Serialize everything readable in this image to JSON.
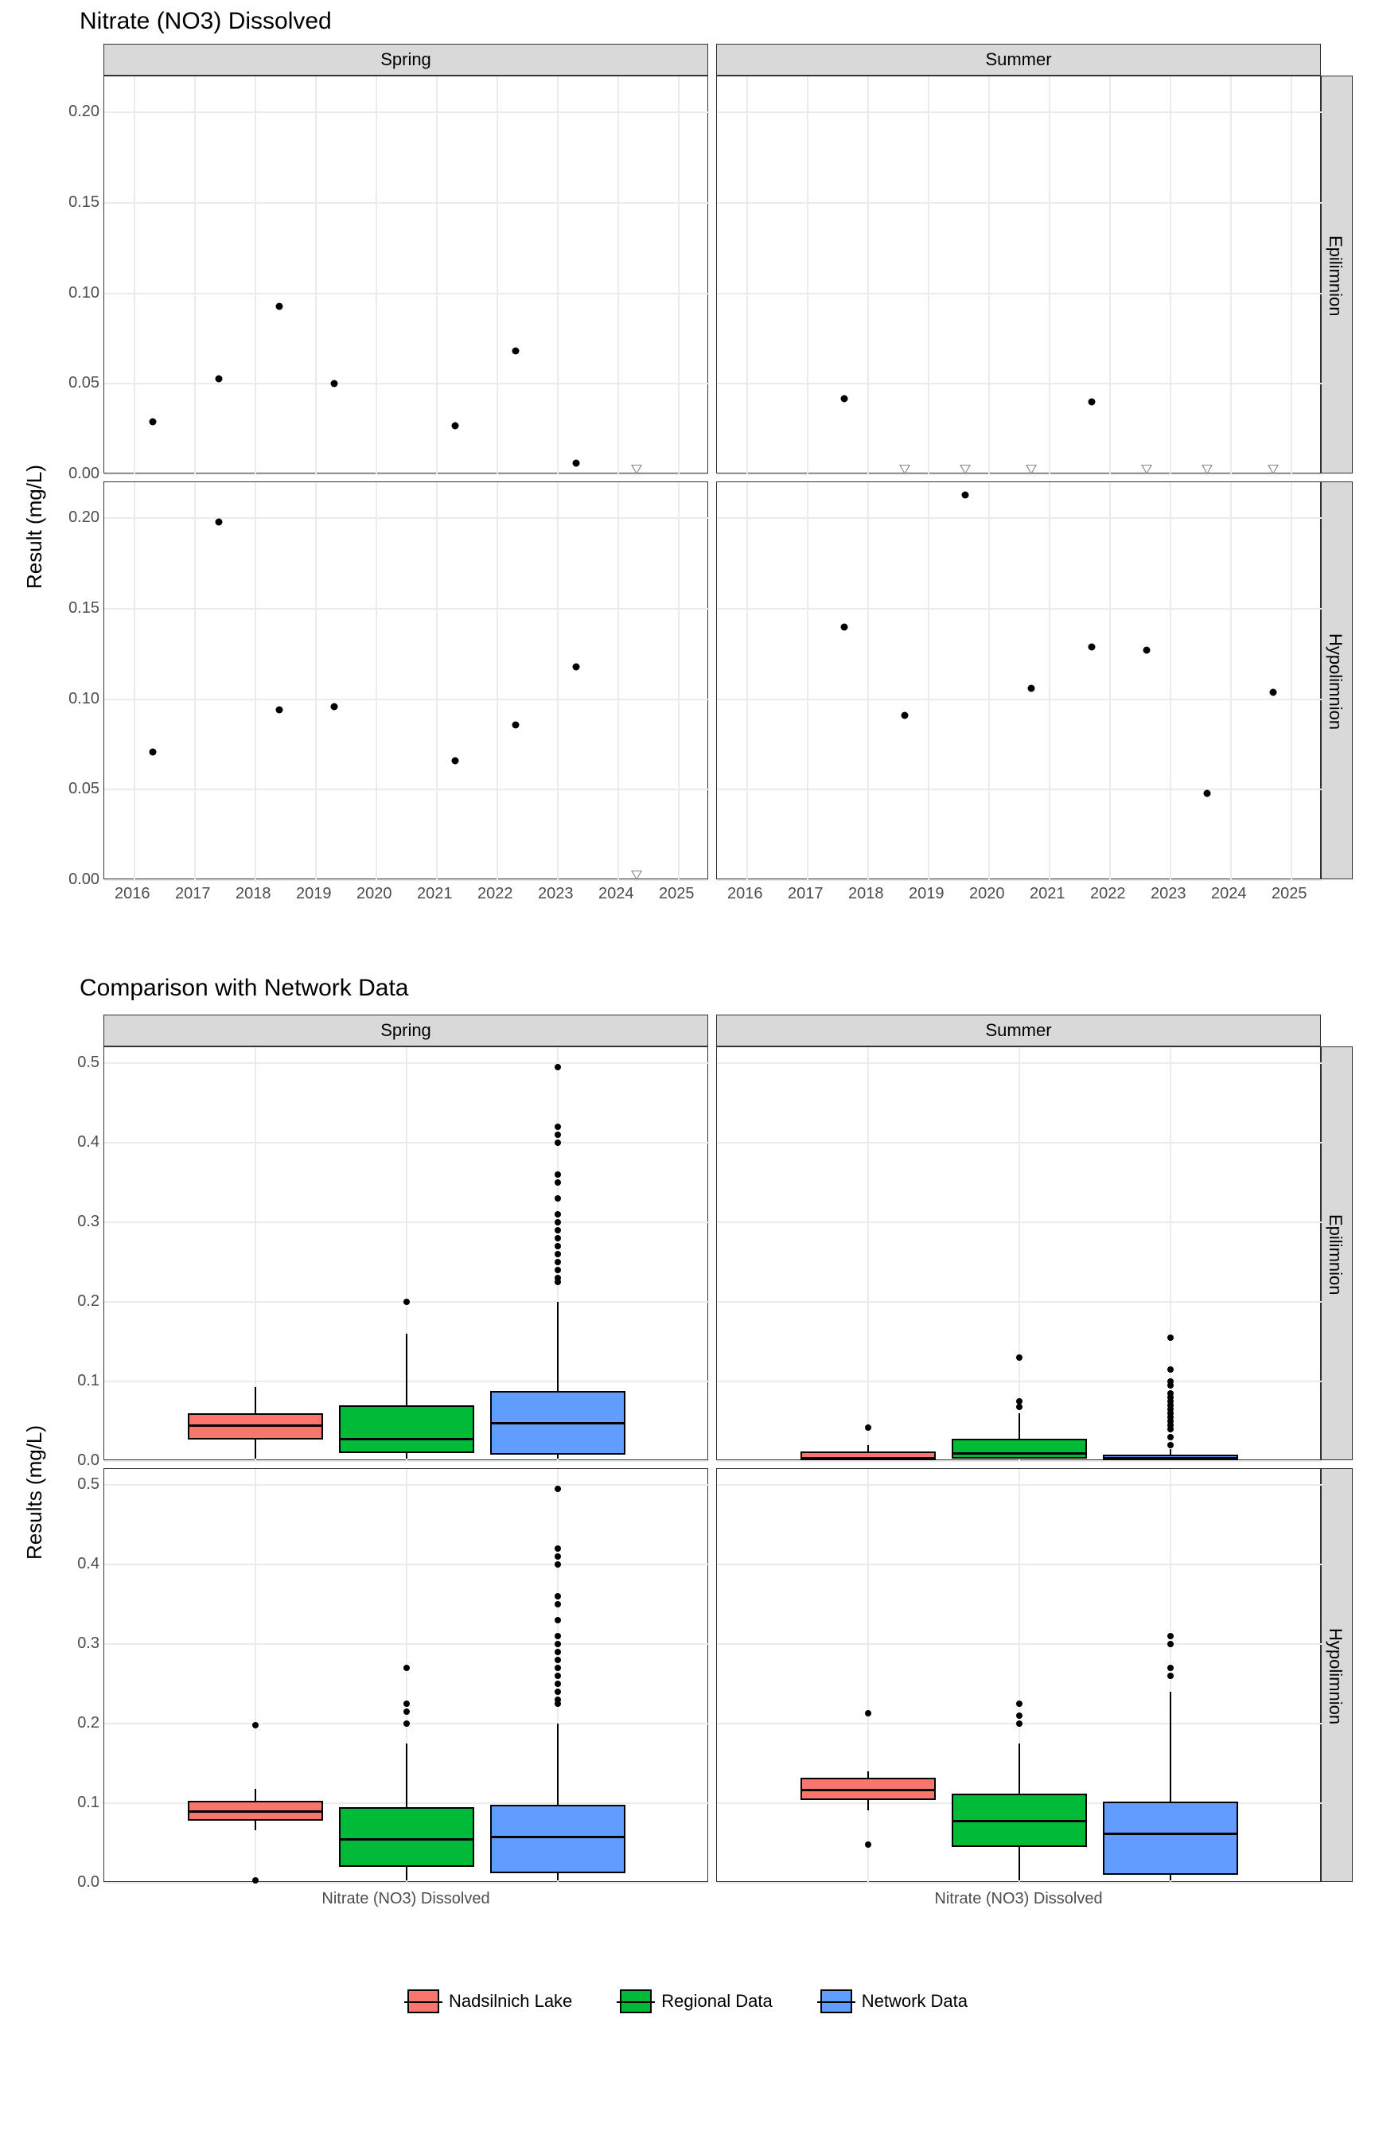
{
  "chart_data": [
    {
      "type": "scatter",
      "title": "Nitrate (NO3) Dissolved",
      "ylabel": "Result (mg/L)",
      "ylim": [
        0,
        0.22
      ],
      "yticks": [
        0.0,
        0.05,
        0.1,
        0.15,
        0.2
      ],
      "xlim": [
        2015.5,
        2025.5
      ],
      "xticks": [
        2016,
        2017,
        2018,
        2019,
        2020,
        2021,
        2022,
        2023,
        2024,
        2025
      ],
      "col_facets": [
        "Spring",
        "Summer"
      ],
      "row_facets": [
        "Epilimnion",
        "Hypolimnion"
      ],
      "series": [
        {
          "name": "detect",
          "marker": "point"
        },
        {
          "name": "below_mdl",
          "marker": "triangle"
        }
      ],
      "data": {
        "Spring": {
          "Epilimnion": {
            "detect": [
              [
                2016.3,
                0.029
              ],
              [
                2017.4,
                0.053
              ],
              [
                2018.4,
                0.093
              ],
              [
                2019.3,
                0.05
              ],
              [
                2021.3,
                0.027
              ],
              [
                2022.3,
                0.068
              ],
              [
                2023.3,
                0.006
              ]
            ],
            "below_mdl": [
              [
                2024.3,
                0.0025
              ]
            ]
          },
          "Hypolimnion": {
            "detect": [
              [
                2016.3,
                0.071
              ],
              [
                2017.4,
                0.198
              ],
              [
                2018.4,
                0.094
              ],
              [
                2019.3,
                0.096
              ],
              [
                2021.3,
                0.066
              ],
              [
                2022.3,
                0.086
              ],
              [
                2023.3,
                0.118
              ]
            ],
            "below_mdl": [
              [
                2024.3,
                0.0025
              ]
            ]
          }
        },
        "Summer": {
          "Epilimnion": {
            "detect": [
              [
                2017.6,
                0.042
              ],
              [
                2021.7,
                0.04
              ]
            ],
            "below_mdl": [
              [
                2018.6,
                0.0025
              ],
              [
                2019.6,
                0.0025
              ],
              [
                2020.7,
                0.0025
              ],
              [
                2022.6,
                0.0025
              ],
              [
                2023.6,
                0.0025
              ],
              [
                2024.7,
                0.0025
              ]
            ]
          },
          "Hypolimnion": {
            "detect": [
              [
                2017.6,
                0.14
              ],
              [
                2018.6,
                0.091
              ],
              [
                2019.6,
                0.213
              ],
              [
                2020.7,
                0.106
              ],
              [
                2021.7,
                0.129
              ],
              [
                2022.6,
                0.127
              ],
              [
                2023.6,
                0.048
              ],
              [
                2024.7,
                0.104
              ]
            ],
            "below_mdl": []
          }
        }
      }
    },
    {
      "type": "boxplot",
      "title": "Comparison with Network Data",
      "ylabel": "Results (mg/L)",
      "ylim": [
        0,
        0.52
      ],
      "yticks": [
        0.0,
        0.1,
        0.2,
        0.3,
        0.4,
        0.5
      ],
      "col_facets": [
        "Spring",
        "Summer"
      ],
      "row_facets": [
        "Epilimnion",
        "Hypolimnion"
      ],
      "x_category": "Nitrate (NO3) Dissolved",
      "groups": [
        "Nadsilnich Lake",
        "Regional Data",
        "Network Data"
      ],
      "colors": {
        "Nadsilnich Lake": "#F8766D",
        "Regional Data": "#00BA38",
        "Network Data": "#619CFF"
      },
      "boxes": {
        "Spring": {
          "Epilimnion": [
            {
              "group": "Nadsilnich Lake",
              "min": 0.003,
              "q1": 0.027,
              "median": 0.045,
              "q3": 0.06,
              "max": 0.093,
              "outliers": []
            },
            {
              "group": "Regional Data",
              "min": 0.003,
              "q1": 0.01,
              "median": 0.028,
              "q3": 0.07,
              "max": 0.16,
              "outliers": [
                0.2
              ]
            },
            {
              "group": "Network Data",
              "min": 0.003,
              "q1": 0.008,
              "median": 0.048,
              "q3": 0.088,
              "max": 0.2,
              "outliers": [
                0.225,
                0.23,
                0.24,
                0.25,
                0.26,
                0.27,
                0.28,
                0.29,
                0.3,
                0.31,
                0.33,
                0.35,
                0.36,
                0.4,
                0.41,
                0.42,
                0.495
              ]
            }
          ],
          "Hypolimnion": [
            {
              "group": "Nadsilnich Lake",
              "min": 0.066,
              "q1": 0.078,
              "median": 0.09,
              "q3": 0.103,
              "max": 0.118,
              "outliers": [
                0.003,
                0.198
              ]
            },
            {
              "group": "Regional Data",
              "min": 0.003,
              "q1": 0.02,
              "median": 0.055,
              "q3": 0.095,
              "max": 0.175,
              "outliers": [
                0.2,
                0.215,
                0.225,
                0.27
              ]
            },
            {
              "group": "Network Data",
              "min": 0.003,
              "q1": 0.012,
              "median": 0.058,
              "q3": 0.098,
              "max": 0.2,
              "outliers": [
                0.225,
                0.23,
                0.24,
                0.25,
                0.26,
                0.27,
                0.28,
                0.29,
                0.3,
                0.31,
                0.33,
                0.35,
                0.36,
                0.4,
                0.41,
                0.42,
                0.495
              ]
            }
          ]
        },
        "Summer": {
          "Epilimnion": [
            {
              "group": "Nadsilnich Lake",
              "min": 0.003,
              "q1": 0.003,
              "median": 0.003,
              "q3": 0.012,
              "max": 0.02,
              "outliers": [
                0.042
              ]
            },
            {
              "group": "Regional Data",
              "min": 0.003,
              "q1": 0.003,
              "median": 0.01,
              "q3": 0.028,
              "max": 0.06,
              "outliers": [
                0.068,
                0.075,
                0.13
              ]
            },
            {
              "group": "Network Data",
              "min": 0.003,
              "q1": 0.003,
              "median": 0.003,
              "q3": 0.008,
              "max": 0.015,
              "outliers": [
                0.02,
                0.03,
                0.04,
                0.045,
                0.05,
                0.055,
                0.06,
                0.065,
                0.07,
                0.075,
                0.08,
                0.085,
                0.095,
                0.1,
                0.115,
                0.155
              ]
            }
          ],
          "Hypolimnion": [
            {
              "group": "Nadsilnich Lake",
              "min": 0.091,
              "q1": 0.104,
              "median": 0.117,
              "q3": 0.132,
              "max": 0.14,
              "outliers": [
                0.048,
                0.213
              ]
            },
            {
              "group": "Regional Data",
              "min": 0.003,
              "q1": 0.045,
              "median": 0.078,
              "q3": 0.112,
              "max": 0.175,
              "outliers": [
                0.2,
                0.21,
                0.225
              ]
            },
            {
              "group": "Network Data",
              "min": 0.003,
              "q1": 0.01,
              "median": 0.062,
              "q3": 0.102,
              "max": 0.24,
              "outliers": [
                0.26,
                0.27,
                0.3,
                0.31
              ]
            }
          ]
        }
      }
    }
  ],
  "legend_items": [
    "Nadsilnich Lake",
    "Regional Data",
    "Network Data"
  ]
}
